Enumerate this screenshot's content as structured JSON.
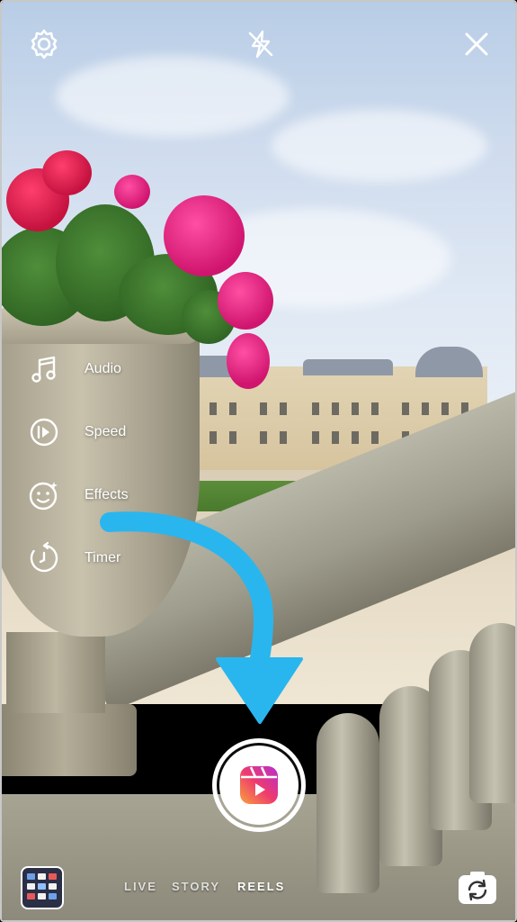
{
  "top_bar": {
    "settings_icon": "settings-gear-icon",
    "flash_icon": "flash-off-icon",
    "close_icon": "close-icon"
  },
  "tools": [
    {
      "icon": "music-note-icon",
      "label": "Audio"
    },
    {
      "icon": "speed-icon",
      "label": "Speed"
    },
    {
      "icon": "effects-face-icon",
      "label": "Effects"
    },
    {
      "icon": "timer-icon",
      "label": "Timer"
    }
  ],
  "annotation": {
    "arrow_color": "#29b6ef"
  },
  "capture": {
    "icon": "reels-icon"
  },
  "modes": [
    {
      "label": "LIVE",
      "active": false
    },
    {
      "label": "STORY",
      "active": false
    },
    {
      "label": "REELS",
      "active": true
    }
  ],
  "bottom_bar": {
    "gallery_icon": "gallery-thumbnail",
    "flip_icon": "flip-camera-icon"
  },
  "colors": {
    "reels_gradient_start": "#f9a23b",
    "reels_gradient_mid": "#ee3a6f",
    "reels_gradient_end": "#b52fd2",
    "ui_white": "#ffffff"
  }
}
